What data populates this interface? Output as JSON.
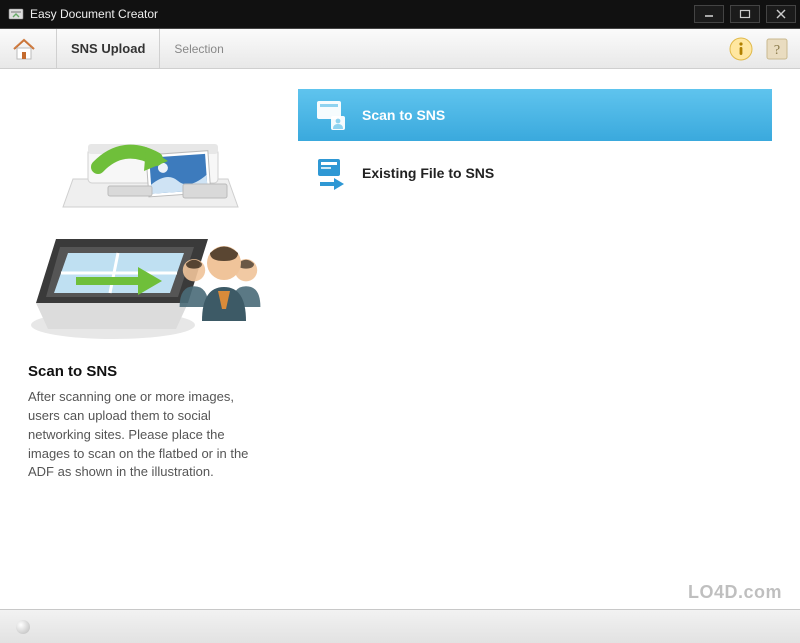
{
  "window": {
    "title": "Easy Document Creator"
  },
  "toolbar": {
    "breadcrumb_primary": "SNS Upload",
    "breadcrumb_secondary": "Selection"
  },
  "left": {
    "title": "Scan to SNS",
    "description": "After scanning one or more images, users can upload them to social networking sites. Please place the images to scan on the flatbed or in the ADF as shown in the illustration."
  },
  "options": [
    {
      "label": "Scan to SNS",
      "selected": true
    },
    {
      "label": "Existing File to SNS",
      "selected": false
    }
  ],
  "watermark": "LO4D.com"
}
